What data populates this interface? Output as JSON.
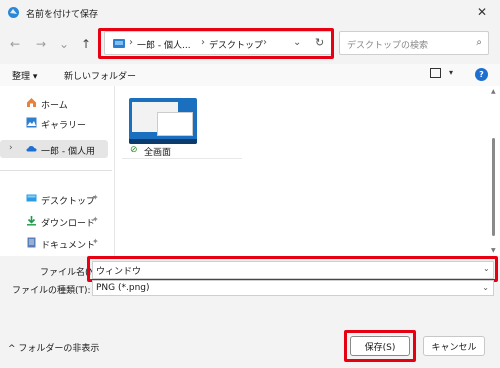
{
  "window": {
    "title": "名前を付けて保存",
    "close_glyph": "✕"
  },
  "nav": {
    "back": "←",
    "forward": "→",
    "recent": "⌄",
    "up": "↑"
  },
  "address": {
    "crumbs": [
      "一郎 - 個人...",
      "デスクトップ"
    ],
    "separator": "›",
    "dropdown": "⌄",
    "refresh": "↻"
  },
  "search": {
    "placeholder": "デスクトップの検索",
    "icon": "⌕"
  },
  "toolbar": {
    "organize": "整理 ▾",
    "new_folder": "新しいフォルダー",
    "help": "?"
  },
  "sidebar": {
    "items": [
      {
        "label": "ホーム"
      },
      {
        "label": "ギャラリー"
      },
      {
        "label": "一郎 - 個人用"
      },
      {
        "label": "デスクトップ"
      },
      {
        "label": "ダウンロード"
      },
      {
        "label": "ドキュメント"
      }
    ],
    "expand_arrow": "›",
    "pin": "📌"
  },
  "content": {
    "items": [
      {
        "label": "全画面",
        "status_icon": "⊘"
      }
    ]
  },
  "form": {
    "filename_label": "ファイル名(N):",
    "filename_value": "ウィンドウ",
    "filetype_label": "ファイルの種類(T):",
    "filetype_value": "PNG (*.png)",
    "dropdown": "⌄"
  },
  "footer": {
    "hide_folders": "^ フォルダーの非表示",
    "save": "保存(S)",
    "cancel": "キャンセル"
  },
  "colors": {
    "highlight": "#e60012",
    "accent": "#1f6fd1"
  }
}
